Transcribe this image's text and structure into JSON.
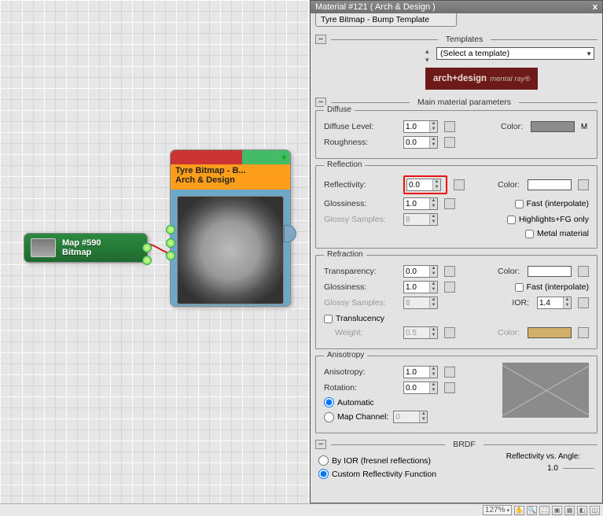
{
  "panel": {
    "title": "Material #121  ( Arch & Design )",
    "close": "x",
    "tab": "Tyre Bitmap - Bump Template"
  },
  "templates": {
    "section": "Templates",
    "select": "(Select a template)",
    "brand_html": "arch+design",
    "brand_tag": "mental ray®"
  },
  "main_params_title": "Main material parameters",
  "diffuse": {
    "legend": "Diffuse",
    "level_label": "Diffuse Level:",
    "level": "1.0",
    "rough_label": "Roughness:",
    "rough": "0.0",
    "color_label": "Color:",
    "color": "#8c8c8c",
    "M": "M"
  },
  "reflection": {
    "legend": "Reflection",
    "reflectivity_label": "Reflectivity:",
    "reflectivity": "0.0",
    "gloss_label": "Glossiness:",
    "gloss": "1.0",
    "samples_label": "Glossy Samples:",
    "samples": "8",
    "color_label": "Color:",
    "color": "#ffffff",
    "fast": "Fast (interpolate)",
    "hl": "Highlights+FG only",
    "metal": "Metal material"
  },
  "refraction": {
    "legend": "Refraction",
    "trans_label": "Transparency:",
    "trans": "0.0",
    "gloss_label": "Glossiness:",
    "gloss": "1.0",
    "samples_label": "Glossy Samples:",
    "samples": "8",
    "color_label": "Color:",
    "color": "#ffffff",
    "fast": "Fast (interpolate)",
    "ior_label": "IOR:",
    "ior": "1.4",
    "transl_label": "Translucency",
    "weight_label": "Weight:",
    "weight": "0.5",
    "transl_color_label": "Color:",
    "transl_color": "#d2b06a"
  },
  "aniso": {
    "legend": "Anisotropy",
    "aniso_label": "Anisotropy:",
    "aniso": "1.0",
    "rot_label": "Rotation:",
    "rot": "0.0",
    "auto": "Automatic",
    "mapch_label": "Map Channel:",
    "mapch": "0"
  },
  "brdf": {
    "legend": "BRDF",
    "byior": "By IOR (fresnel reflections)",
    "custom": "Custom Reflectivity Function",
    "reflvs": "Reflectivity vs. Angle:",
    "val": "1.0"
  },
  "nodes": {
    "bitmap": {
      "l1": "Map #590",
      "l2": "Bitmap"
    },
    "material": {
      "l1": "Tyre Bitmap - B...",
      "l2": "Arch & Design"
    }
  },
  "status": {
    "zoom": "127%"
  }
}
